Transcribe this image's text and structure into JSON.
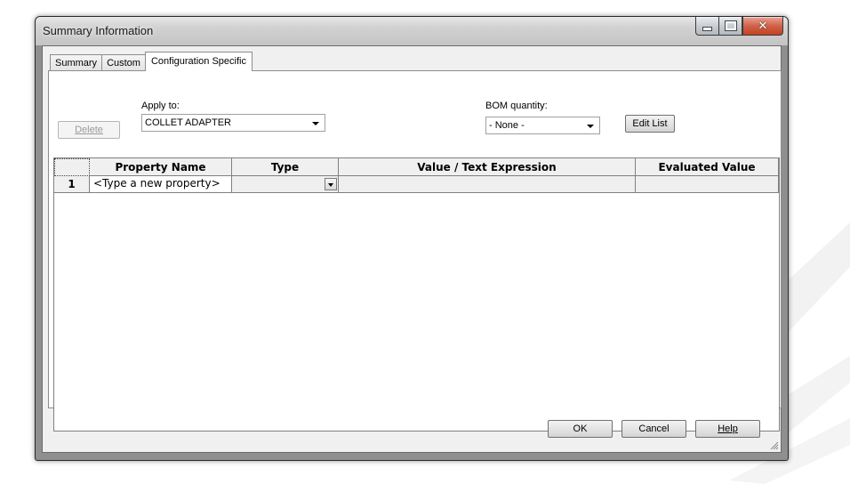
{
  "window": {
    "title": "Summary Information"
  },
  "tabs": [
    {
      "label": "Summary",
      "active": false
    },
    {
      "label": "Custom",
      "active": false
    },
    {
      "label": "Configuration Specific",
      "active": true
    }
  ],
  "toolbar": {
    "delete_label": "Delete",
    "apply_to_label": "Apply to:",
    "apply_to_value": "COLLET ADAPTER",
    "bom_quantity_label": "BOM quantity:",
    "bom_quantity_value": "- None -",
    "edit_list_label": "Edit List"
  },
  "grid": {
    "columns": [
      "Property Name",
      "Type",
      "Value / Text Expression",
      "Evaluated Value"
    ],
    "rows": [
      {
        "number": "1",
        "property_name": "<Type a new property>",
        "type": "",
        "value": "",
        "evaluated": ""
      }
    ]
  },
  "footer": {
    "ok_label": "OK",
    "cancel_label": "Cancel",
    "help_label": "Help"
  },
  "colors": {
    "title_bar": "#d2d2d2",
    "client_bg": "#f0f0f0",
    "close_button": "#c5401f",
    "grid_header": "#f0f0f0"
  }
}
